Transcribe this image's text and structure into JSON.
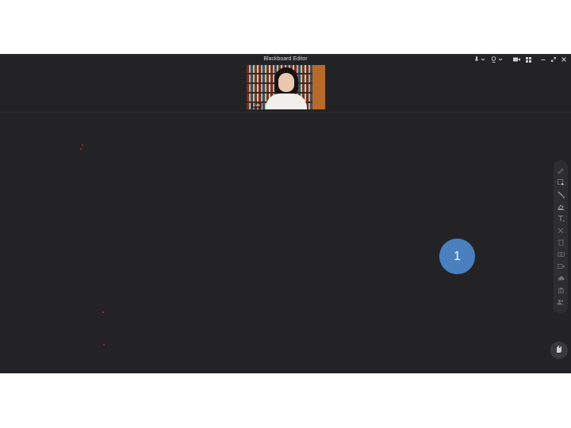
{
  "window": {
    "title": "Blackboard Editor"
  },
  "title_controls": [
    "microphone-icon",
    "chevron-down-icon",
    "webcam-icon",
    "chevron-down-icon",
    "video-camera-icon",
    "grid-layout-icon",
    "minimize-icon",
    "restore-icon",
    "close-icon"
  ],
  "video": {
    "participant_name": "Eva"
  },
  "toolbar": {
    "tools": [
      "pen-icon",
      "select-icon",
      "line-icon",
      "eraser-icon",
      "text-icon",
      "clear-icon",
      "delete-icon",
      "camera-icon",
      "video-icon",
      "cloud-icon",
      "bank-icon",
      "participants-icon"
    ]
  },
  "hand_button": {
    "label": ""
  },
  "step_badge": {
    "number": "1",
    "color": "#4a7fc0"
  },
  "colors": {
    "background": "#232325",
    "accent": "#4a7fc0",
    "marker": "#b03022"
  }
}
